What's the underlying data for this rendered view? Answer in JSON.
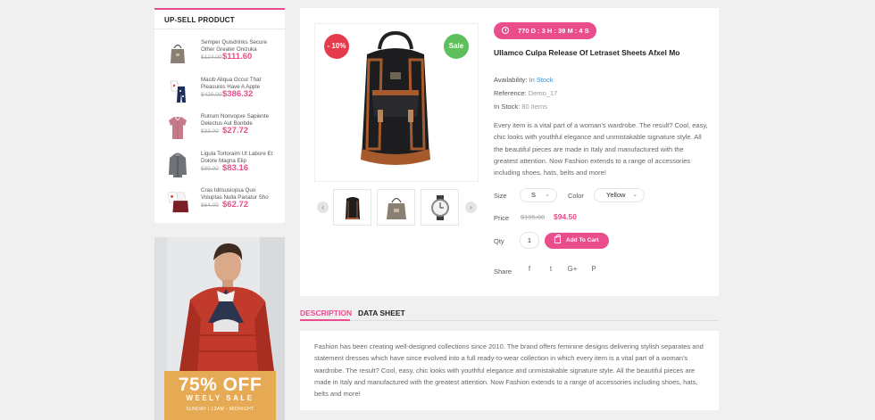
{
  "upsell": {
    "title": "UP-SELL PRODUCT",
    "items": [
      {
        "name": "Semper Quisdrinks Secure Other Greater Onizuka",
        "old_price": "$124.00",
        "price": "$111.60",
        "icon": "tote-bag-icon"
      },
      {
        "name": "Macib Aliqua Occur That Pleasures Have A Apple",
        "old_price": "$429.00",
        "price": "$386.32",
        "icon": "baby-clothes-icon"
      },
      {
        "name": "Rutrum Nonvopxe Sapiente Delectus Aut Bonbde",
        "old_price": "$33.00",
        "price": "$27.72",
        "icon": "shirt-icon"
      },
      {
        "name": "Ligula Tortoraim Ut Labore Et Dolore Magna Elip",
        "old_price": "$99.00",
        "price": "$83.16",
        "icon": "jacket-icon"
      },
      {
        "name": "Cras Idrisusiopsa Quo Voluptas Nulla Pariatur Sho",
        "old_price": "$64.00",
        "price": "$62.72",
        "icon": "outfit-icon"
      }
    ]
  },
  "banner": {
    "headline": "75% OFF",
    "subline": "WEELY SALE",
    "small": "SUNDAY  |  12AM - MIDNIGHT",
    "colors": {
      "box": "#e6aa55",
      "jacket": "#c23a2b"
    }
  },
  "product": {
    "discount_badge": "- 10%",
    "sale_badge": "Sale",
    "countdown": "770 D : 3 H : 39 M : 4 S",
    "title": "Ullamco Culpa Release Of Letraset Sheets Afxel Mo",
    "availability_label": "Availability:",
    "availability_value": "In Stock",
    "reference_label": "Reference:",
    "reference_value": "Demo_17",
    "instock_label": "In Stock:",
    "instock_value": "80 Items",
    "description": "Every item is a vital part of a woman's wardrobe. The result? Cool, easy, chic looks with youthful elegance and unmistakable signature style. All the beautiful pieces are made in Italy and manufactured with the greatest attention. Now Fashion extends to a range of accessories including shoes, hats, belts and more!",
    "size_label": "Size",
    "size_value": "S",
    "color_label": "Color",
    "color_value": "Yellow",
    "price_label": "Price",
    "old_price": "$105.00",
    "price": "$94.50",
    "qty_label": "Qty",
    "qty_value": "1",
    "cart_label": "Add To Cart",
    "share_label": "Share",
    "social": [
      "f",
      "t",
      "G+",
      "P"
    ],
    "thumbnails": [
      "backpack-icon",
      "handbag-icon",
      "watch-icon"
    ],
    "colors": {
      "accent": "#e94d8b",
      "discount": "#e63b4c",
      "sale": "#5ec05c"
    }
  },
  "tabs": {
    "items": [
      "DESCRIPTION",
      "DATA SHEET"
    ],
    "active": "DESCRIPTION",
    "text": "Fashion has been creating well-designed collections since 2010. The brand offers feminine designs delivering stylish separates and statement dresses which have since evolved into a full ready-to-wear collection in which every item is a vital part of a woman's wardrobe. The result? Cool, easy, chic looks with youthful elegance and unmistakable signature style. All the beautiful pieces are made in Italy and manufactured with the greatest attention. Now Fashion extends to a range of accessories including shoes, hats, belts and more!"
  }
}
